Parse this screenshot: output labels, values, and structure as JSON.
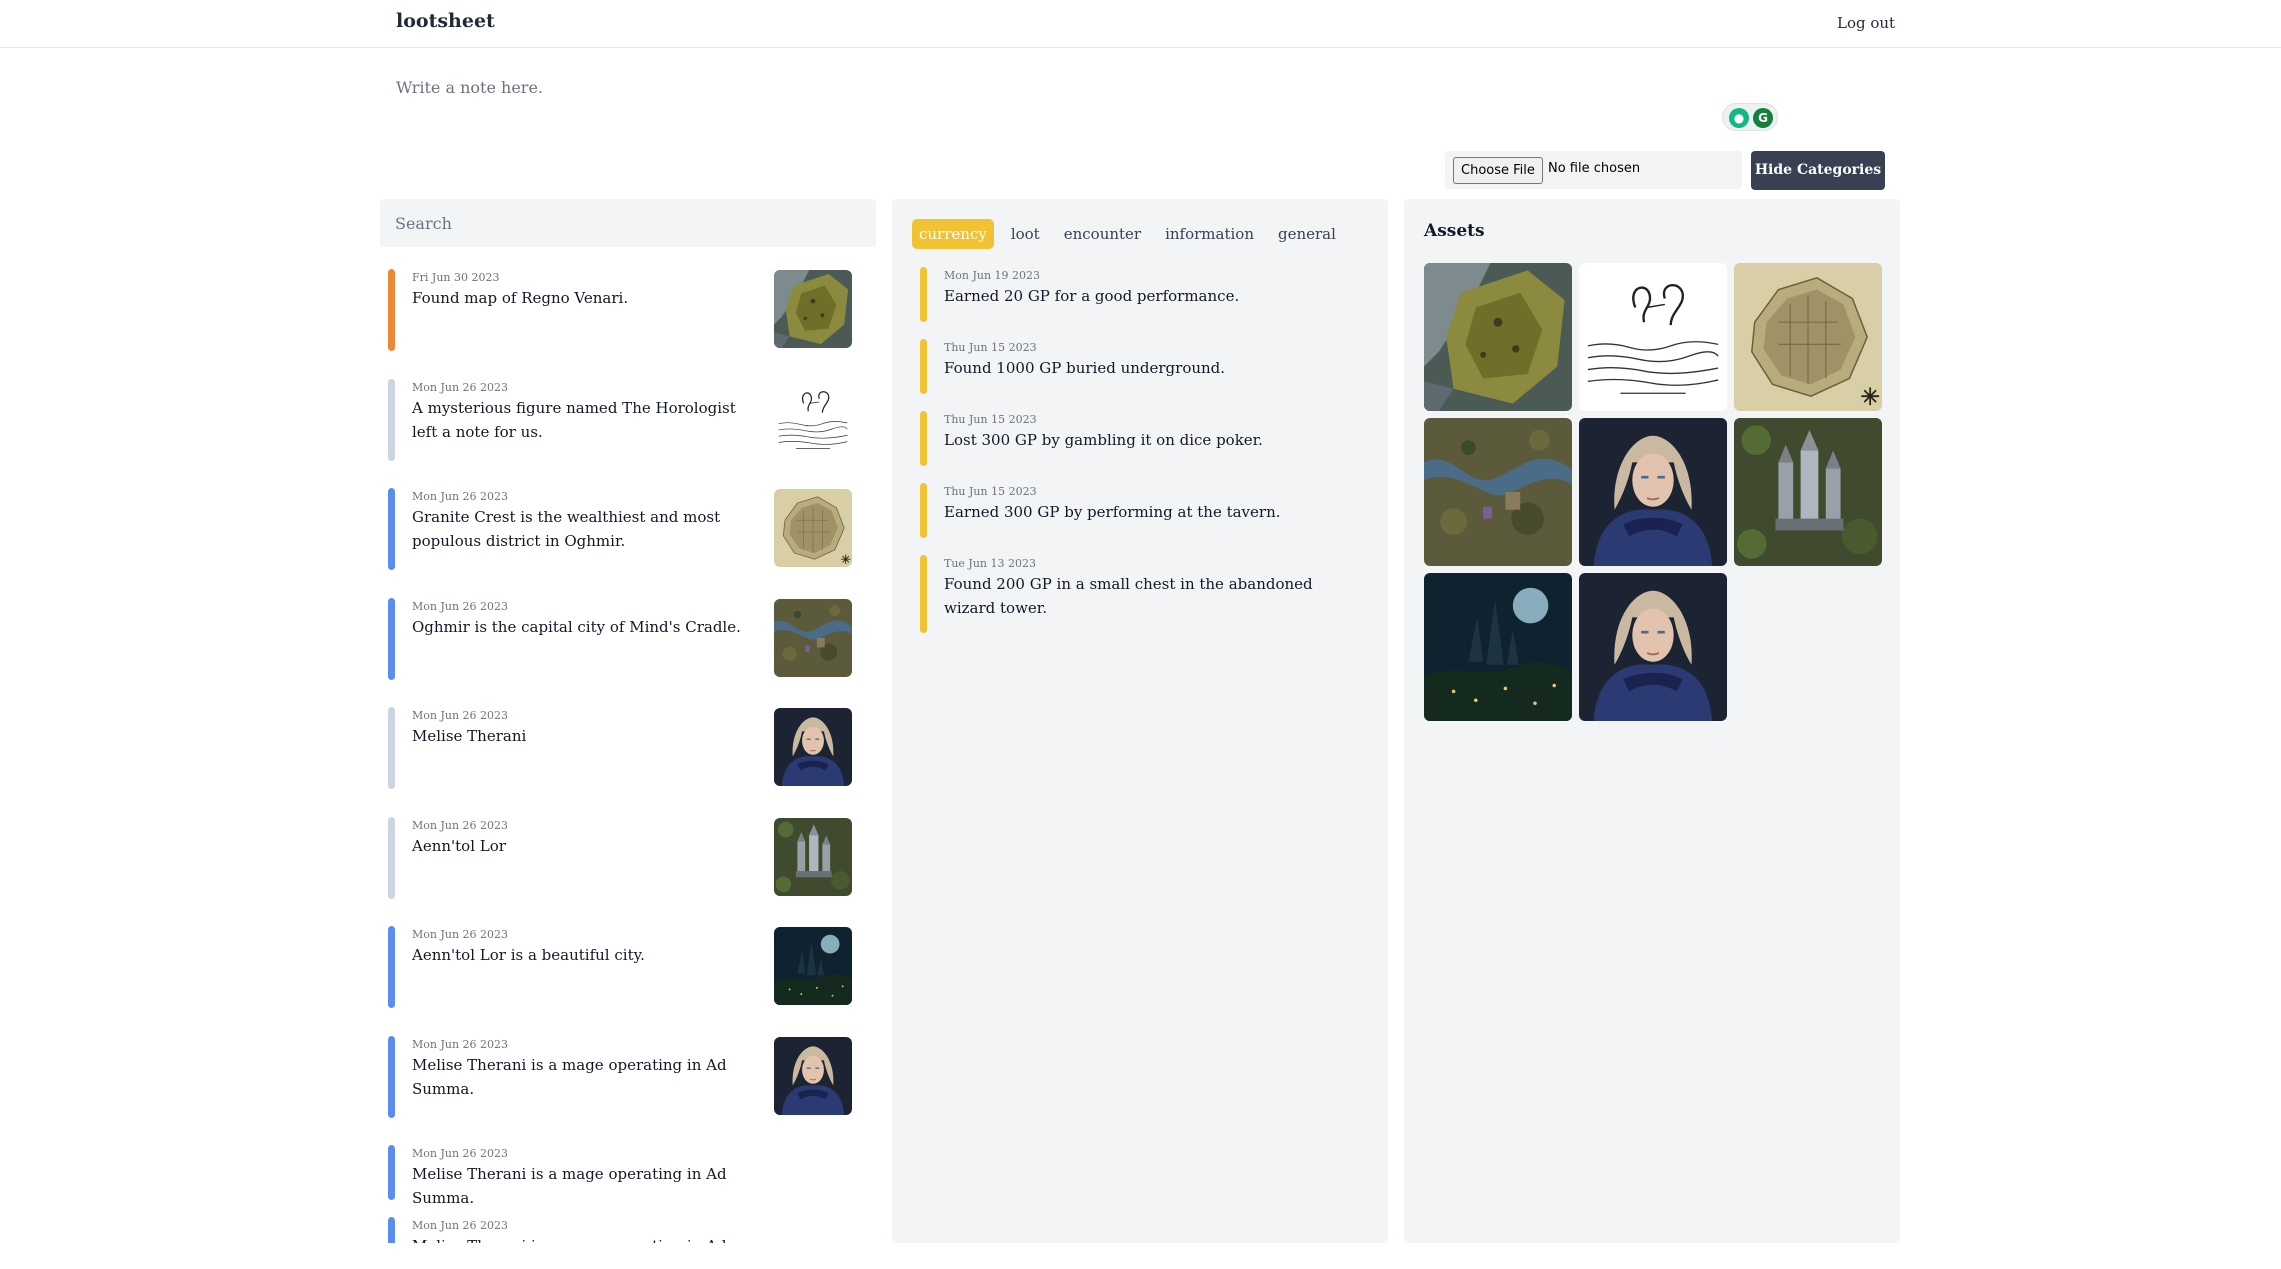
{
  "header": {
    "brand": "lootsheet",
    "logout_label": "Log out"
  },
  "note": {
    "placeholder": "Write a note here."
  },
  "extension": {
    "icons": [
      "bulb-icon",
      "grammar-icon"
    ]
  },
  "upload": {
    "choose_label": "Choose File",
    "status": "No file chosen"
  },
  "hide_categories_label": "Hide Categories",
  "search": {
    "placeholder": "Search"
  },
  "notes": [
    {
      "date": "Fri Jun 30 2023",
      "text": "Found map of Regno Venari.",
      "category_color": "#ed8936",
      "thumb": "regional-map"
    },
    {
      "date": "Mon Jun 26 2023",
      "text": "A mysterious figure named The Horologist left a note for us.",
      "category_color": "#cbd5e1",
      "thumb": "handwritten-note"
    },
    {
      "date": "Mon Jun 26 2023",
      "text": "Granite Crest is the wealthiest and most populous district in Oghmir.",
      "category_color": "#5b8def",
      "thumb": "city-map"
    },
    {
      "date": "Mon Jun 26 2023",
      "text": "Oghmir is the capital city of Mind's Cradle.",
      "category_color": "#5b8def",
      "thumb": "terrain-map"
    },
    {
      "date": "Mon Jun 26 2023",
      "text": "Melise Therani",
      "category_color": "#cbd5e1",
      "thumb": "portrait"
    },
    {
      "date": "Mon Jun 26 2023",
      "text": "Aenn'tol Lor",
      "category_color": "#cbd5e1",
      "thumb": "fantasy-city"
    },
    {
      "date": "Mon Jun 26 2023",
      "text": "Aenn'tol Lor is a beautiful city.",
      "category_color": "#5b8def",
      "thumb": "night-city"
    },
    {
      "date": "Mon Jun 26 2023",
      "text": "Melise Therani is a mage operating in Ad Summa.",
      "category_color": "#5b8def",
      "thumb": "portrait"
    },
    {
      "date": "Mon Jun 26 2023",
      "text": "Melise Therani is a mage operating in Ad Summa.",
      "category_color": "#5b8def",
      "thumb": ""
    },
    {
      "date": "Mon Jun 26 2023",
      "text": "Melise Therani is a mage operating in Ad Summa.",
      "category_color": "#5b8def",
      "thumb": ""
    }
  ],
  "tabs": [
    {
      "label": "currency",
      "active": true
    },
    {
      "label": "loot",
      "active": false
    },
    {
      "label": "encounter",
      "active": false
    },
    {
      "label": "information",
      "active": false
    },
    {
      "label": "general",
      "active": false
    }
  ],
  "currency_entries": [
    {
      "date": "Mon Jun 19 2023",
      "text": "Earned 20 GP for a good performance."
    },
    {
      "date": "Thu Jun 15 2023",
      "text": "Found 1000 GP buried underground."
    },
    {
      "date": "Thu Jun 15 2023",
      "text": "Lost 300 GP by gambling it on dice poker."
    },
    {
      "date": "Thu Jun 15 2023",
      "text": "Earned 300 GP by performing at the tavern."
    },
    {
      "date": "Tue Jun 13 2023",
      "text": "Found 200 GP in a small chest in the abandoned wizard tower."
    }
  ],
  "assets": {
    "title": "Assets",
    "items": [
      "regional-map",
      "handwritten-note",
      "city-map",
      "terrain-map",
      "portrait",
      "fantasy-city",
      "night-city",
      "portrait"
    ]
  },
  "colors": {
    "accent": "#f1c232",
    "button_dark": "#374151",
    "panel_bg": "#f3f4f6"
  }
}
